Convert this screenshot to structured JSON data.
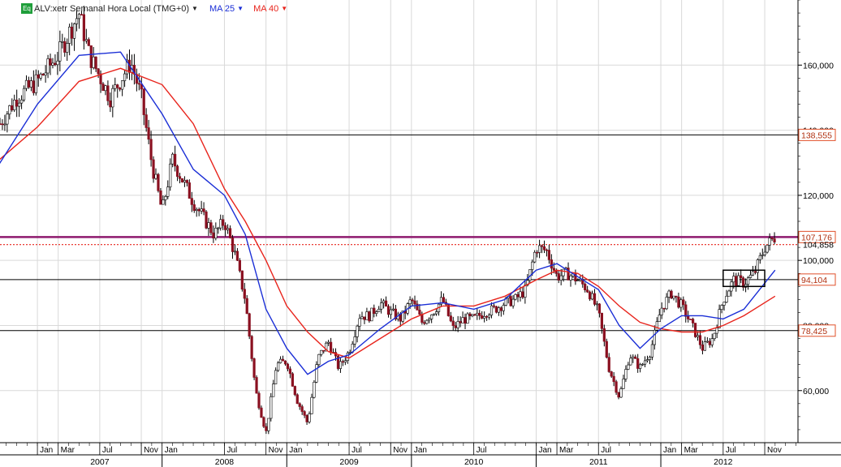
{
  "header": {
    "badge": "Eq",
    "symbol_label": "ALV:xetr Semanal Hora Local (TMG+0)",
    "ma1_label": "MA 25",
    "ma2_label": "MA 40",
    "dropdown_glyph": "▼"
  },
  "colors": {
    "price": "#000000",
    "ma25": "#1a2ed6",
    "ma40": "#e8241c",
    "resistance": "#8e1a6e",
    "label_border": "#e0502a",
    "label_text": "#b03010",
    "grid": "#d9d9d9"
  },
  "chart_data": {
    "type": "candlestick",
    "title": "ALV:xetr Semanal Hora Local (TMG+0)",
    "y_axis": {
      "range": [
        44000,
        180000
      ],
      "ticks": [
        "60,000",
        "80,000",
        "100,000",
        "120,000",
        "140,000",
        "160,000"
      ],
      "side": "right"
    },
    "x_axis": {
      "months": [
        {
          "label": "Jan",
          "date": "2007-01"
        },
        {
          "label": "Mar",
          "date": "2007-03"
        },
        {
          "label": "Jul",
          "date": "2007-07"
        },
        {
          "label": "Nov",
          "date": "2007-11"
        },
        {
          "label": "Jan",
          "date": "2008-01"
        },
        {
          "label": "Jul",
          "date": "2008-07"
        },
        {
          "label": "Nov",
          "date": "2008-11"
        },
        {
          "label": "Jan",
          "date": "2009-01"
        },
        {
          "label": "Jul",
          "date": "2009-07"
        },
        {
          "label": "Nov",
          "date": "2009-11"
        },
        {
          "label": "Jan",
          "date": "2010-01"
        },
        {
          "label": "Jul",
          "date": "2010-07"
        },
        {
          "label": "Jan",
          "date": "2011-01"
        },
        {
          "label": "Mar",
          "date": "2011-03"
        },
        {
          "label": "Jul",
          "date": "2011-07"
        },
        {
          "label": "Jan",
          "date": "2012-01"
        },
        {
          "label": "Mar",
          "date": "2012-03"
        },
        {
          "label": "Jul",
          "date": "2012-07"
        },
        {
          "label": "Nov",
          "date": "2012-11"
        }
      ],
      "years": [
        {
          "label": "2007",
          "date": "2007-07"
        },
        {
          "label": "2008",
          "date": "2008-07"
        },
        {
          "label": "2009",
          "date": "2009-07"
        },
        {
          "label": "2010",
          "date": "2010-07"
        },
        {
          "label": "2011",
          "date": "2011-07"
        },
        {
          "label": "2012",
          "date": "2012-07"
        }
      ],
      "year_starts": [
        "2008-01",
        "2009-01",
        "2010-01",
        "2011-01",
        "2012-01"
      ]
    },
    "price_path": [
      [
        "2006-09",
        140000
      ],
      [
        "2006-11",
        150000
      ],
      [
        "2007-01",
        155000
      ],
      [
        "2007-03",
        163000
      ],
      [
        "2007-05",
        176000
      ],
      [
        "2007-06",
        163000
      ],
      [
        "2007-08",
        150000
      ],
      [
        "2007-10",
        161000
      ],
      [
        "2007-11",
        150000
      ],
      [
        "2007-12",
        130000
      ],
      [
        "2008-01",
        115000
      ],
      [
        "2008-02",
        131000
      ],
      [
        "2008-04",
        118000
      ],
      [
        "2008-06",
        108000
      ],
      [
        "2008-07",
        112000
      ],
      [
        "2008-08",
        102000
      ],
      [
        "2008-09",
        88000
      ],
      [
        "2008-10",
        60000
      ],
      [
        "2008-11",
        47000
      ],
      [
        "2008-12",
        68000
      ],
      [
        "2009-01",
        69000
      ],
      [
        "2009-02",
        57000
      ],
      [
        "2009-03",
        50000
      ],
      [
        "2009-04",
        70000
      ],
      [
        "2009-05",
        75000
      ],
      [
        "2009-06",
        67000
      ],
      [
        "2009-07",
        72000
      ],
      [
        "2009-08",
        83000
      ],
      [
        "2009-09",
        83000
      ],
      [
        "2009-10",
        87000
      ],
      [
        "2009-11",
        84000
      ],
      [
        "2009-12",
        82000
      ],
      [
        "2010-01",
        88000
      ],
      [
        "2010-02",
        81000
      ],
      [
        "2010-03",
        84000
      ],
      [
        "2010-04",
        88000
      ],
      [
        "2010-05",
        79000
      ],
      [
        "2010-06",
        82000
      ],
      [
        "2010-07",
        82000
      ],
      [
        "2010-08",
        84000
      ],
      [
        "2010-09",
        85000
      ],
      [
        "2010-10",
        87000
      ],
      [
        "2010-11",
        88000
      ],
      [
        "2010-12",
        91000
      ],
      [
        "2011-01",
        104000
      ],
      [
        "2011-02",
        103000
      ],
      [
        "2011-03",
        95000
      ],
      [
        "2011-04",
        96000
      ],
      [
        "2011-05",
        94000
      ],
      [
        "2011-06",
        91000
      ],
      [
        "2011-07",
        84000
      ],
      [
        "2011-08",
        67000
      ],
      [
        "2011-09",
        58000
      ],
      [
        "2011-10",
        71000
      ],
      [
        "2011-11",
        67000
      ],
      [
        "2011-12",
        72000
      ],
      [
        "2012-01",
        85000
      ],
      [
        "2012-02",
        90000
      ],
      [
        "2012-03",
        86000
      ],
      [
        "2012-04",
        80000
      ],
      [
        "2012-05",
        73000
      ],
      [
        "2012-06",
        76000
      ],
      [
        "2012-07",
        88000
      ],
      [
        "2012-08",
        94000
      ],
      [
        "2012-09",
        93000
      ],
      [
        "2012-10",
        96000
      ],
      [
        "2012-11",
        104000
      ],
      [
        "2012-12",
        107176
      ]
    ],
    "ma25_path": [
      [
        "2006-09",
        128000
      ],
      [
        "2007-01",
        148000
      ],
      [
        "2007-05",
        163000
      ],
      [
        "2007-09",
        164000
      ],
      [
        "2008-01",
        145000
      ],
      [
        "2008-04",
        128000
      ],
      [
        "2008-07",
        120000
      ],
      [
        "2008-09",
        108000
      ],
      [
        "2008-11",
        85000
      ],
      [
        "2009-01",
        73000
      ],
      [
        "2009-03",
        65000
      ],
      [
        "2009-05",
        69000
      ],
      [
        "2009-07",
        71000
      ],
      [
        "2009-10",
        79000
      ],
      [
        "2010-01",
        86000
      ],
      [
        "2010-04",
        87000
      ],
      [
        "2010-07",
        85000
      ],
      [
        "2010-10",
        88000
      ],
      [
        "2011-01",
        97000
      ],
      [
        "2011-03",
        99000
      ],
      [
        "2011-05",
        95000
      ],
      [
        "2011-07",
        91000
      ],
      [
        "2011-09",
        80000
      ],
      [
        "2011-11",
        73000
      ],
      [
        "2012-01",
        79000
      ],
      [
        "2012-03",
        83000
      ],
      [
        "2012-05",
        83000
      ],
      [
        "2012-07",
        82000
      ],
      [
        "2012-09",
        85000
      ],
      [
        "2012-12",
        97000
      ]
    ],
    "ma40_path": [
      [
        "2006-09",
        130000
      ],
      [
        "2007-01",
        141000
      ],
      [
        "2007-05",
        155000
      ],
      [
        "2007-09",
        159000
      ],
      [
        "2008-01",
        154000
      ],
      [
        "2008-04",
        142000
      ],
      [
        "2008-07",
        122000
      ],
      [
        "2008-09",
        112000
      ],
      [
        "2008-11",
        100000
      ],
      [
        "2009-01",
        86000
      ],
      [
        "2009-03",
        78000
      ],
      [
        "2009-05",
        72000
      ],
      [
        "2009-07",
        70000
      ],
      [
        "2009-10",
        76000
      ],
      [
        "2010-01",
        82000
      ],
      [
        "2010-04",
        86000
      ],
      [
        "2010-07",
        86000
      ],
      [
        "2010-10",
        89000
      ],
      [
        "2011-01",
        94000
      ],
      [
        "2011-03",
        97000
      ],
      [
        "2011-05",
        96000
      ],
      [
        "2011-07",
        92000
      ],
      [
        "2011-09",
        86000
      ],
      [
        "2011-11",
        81000
      ],
      [
        "2012-01",
        79000
      ],
      [
        "2012-03",
        78000
      ],
      [
        "2012-05",
        78000
      ],
      [
        "2012-07",
        80000
      ],
      [
        "2012-09",
        83000
      ],
      [
        "2012-12",
        89000
      ]
    ],
    "horizontal_levels": [
      {
        "value": 138555,
        "label": "138,555",
        "style": "solid-thin"
      },
      {
        "value": 107176,
        "label": "107,176",
        "style": "resistance"
      },
      {
        "value": 104858,
        "label": "104,858",
        "style": "dotted"
      },
      {
        "value": 94104,
        "label": "94,104",
        "style": "solid-thin"
      },
      {
        "value": 78425,
        "label": "78,425",
        "style": "solid-thin"
      }
    ],
    "annotation_box": {
      "from": "2012-07",
      "to": "2012-11",
      "low": 92000,
      "high": 97000
    }
  }
}
